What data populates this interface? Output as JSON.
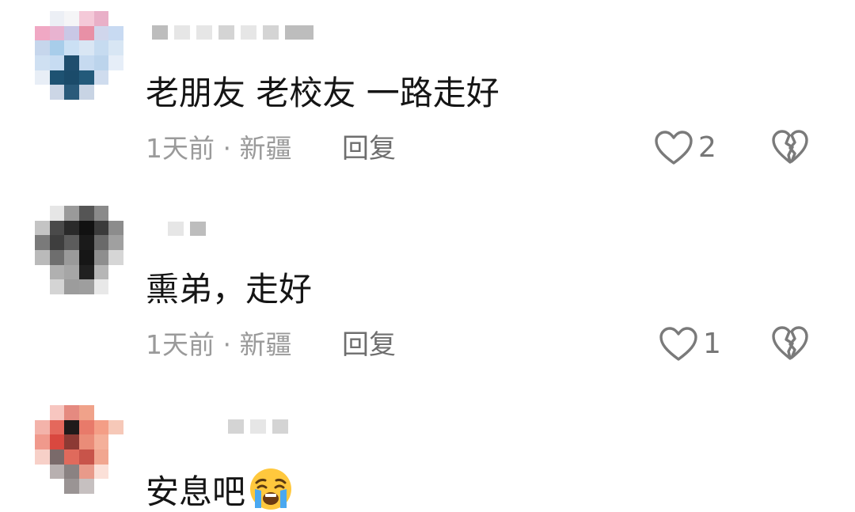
{
  "comments": [
    {
      "text": "老朋友 老校友 一路走好",
      "meta": "1天前 · 新疆",
      "reply_label": "回复",
      "like_count": "2",
      "avatar_colors": [
        "#ffffff",
        "#eceff5",
        "#f5f5f7",
        "#f4c9d8",
        "#e9b0c8",
        "#ffffff",
        "#f0a8c4",
        "#e8b3d0",
        "#c9c8e6",
        "#e890a6",
        "#d0d6ec",
        "#c8daf2",
        "#c6d6ec",
        "#a8cdea",
        "#cbe0f4",
        "#d9e6f4",
        "#c6dbf0",
        "#d8e6f4",
        "#cfe0f2",
        "#c7dcf2",
        "#1f4e6e",
        "#c6daf0",
        "#bcd4ec",
        "#e6eef8",
        "#e8eef6",
        "#1e5272",
        "#1b4b6a",
        "#235a7a",
        "#cfdcee",
        "#ffffff",
        "#ffffff",
        "#ccd6e6",
        "#2a5a7a",
        "#c8d4e4",
        "#ffffff",
        "#ffffff"
      ]
    },
    {
      "text": "熏弟，走好",
      "meta": "1天前 · 新疆",
      "reply_label": "回复",
      "like_count": "1",
      "avatar_colors": [
        "#ffffff",
        "#e6e6e6",
        "#9a9a9a",
        "#555555",
        "#8a8a8a",
        "#ffffff",
        "#c4c4c4",
        "#4a4a4a",
        "#2a2a2a",
        "#111111",
        "#3b3b3b",
        "#8c8c8c",
        "#7a7a7a",
        "#3e3e3e",
        "#5c5c5c",
        "#1a1a1a",
        "#6a6a6a",
        "#a0a0a0",
        "#bababa",
        "#6e6e6e",
        "#9a9a9a",
        "#161616",
        "#8e8e8e",
        "#d6d6d6",
        "#ffffff",
        "#b0b0b0",
        "#a6a6a6",
        "#202020",
        "#b6b6b6",
        "#ffffff",
        "#ffffff",
        "#d4d4d4",
        "#9c9c9c",
        "#9e9e9e",
        "#e8e8e8",
        "#ffffff"
      ]
    },
    {
      "text": "安息吧",
      "avatar_colors": [
        "#ffffff",
        "#f7c6c0",
        "#e58a80",
        "#f0a28a",
        "#ffffff",
        "#ffffff",
        "#f3b3aa",
        "#e4685c",
        "#1f1a1a",
        "#e87a6a",
        "#f49e86",
        "#f6c8b8",
        "#f0998c",
        "#d9483f",
        "#8c3a34",
        "#ea8c78",
        "#f4b09a",
        "#ffffff",
        "#f7d0c8",
        "#7a6a6a",
        "#e06a5c",
        "#c8544a",
        "#f1a690",
        "#ffffff",
        "#ffffff",
        "#b8b0b0",
        "#8a8282",
        "#e89a8a",
        "#fbe0d8",
        "#ffffff",
        "#ffffff",
        "#ffffff",
        "#9a9494",
        "#c6c0c0",
        "#ffffff",
        "#ffffff"
      ]
    }
  ],
  "icons": {
    "like": "heart-outline-icon",
    "dislike": "broken-heart-icon",
    "emoji": "loudly-crying-face-emoji"
  }
}
